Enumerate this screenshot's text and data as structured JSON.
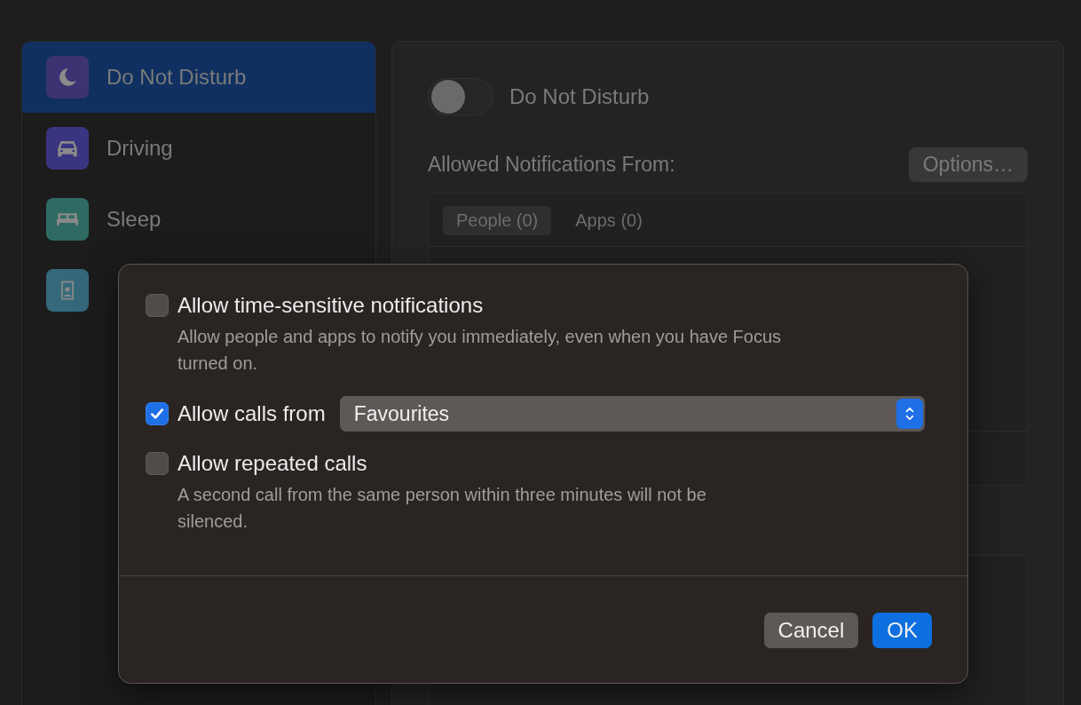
{
  "sidebar": {
    "items": [
      {
        "label": "Do Not Disturb",
        "selected": true,
        "color": "#3d3373"
      },
      {
        "label": "Driving",
        "selected": false,
        "color": "#3a3580"
      },
      {
        "label": "Sleep",
        "selected": false,
        "color": "#2f6b63"
      },
      {
        "selected": false,
        "color": "#34687a"
      }
    ]
  },
  "focus": {
    "toggle": {
      "label": "Do Not Disturb",
      "on": false
    },
    "allowed_label": "Allowed Notifications From:",
    "options_button": "Options…",
    "tabs": [
      {
        "label": "People (0)",
        "selected": true
      },
      {
        "label": "Apps (0)",
        "selected": false
      }
    ]
  },
  "sheet": {
    "options": [
      {
        "kind": "checkbox",
        "label": "Allow time-sensitive notifications",
        "checked": false,
        "description": "Allow people and apps to notify you immediately, even when you have Focus turned on."
      },
      {
        "kind": "select",
        "label": "Allow calls from",
        "checked": true,
        "value": "Favourites"
      },
      {
        "kind": "checkbox",
        "label": "Allow repeated calls",
        "checked": false,
        "description": "A second call from the same person within three minutes will not be silenced."
      }
    ],
    "buttons": [
      {
        "label": "Cancel",
        "primary": false
      },
      {
        "label": "OK",
        "primary": true
      }
    ]
  }
}
